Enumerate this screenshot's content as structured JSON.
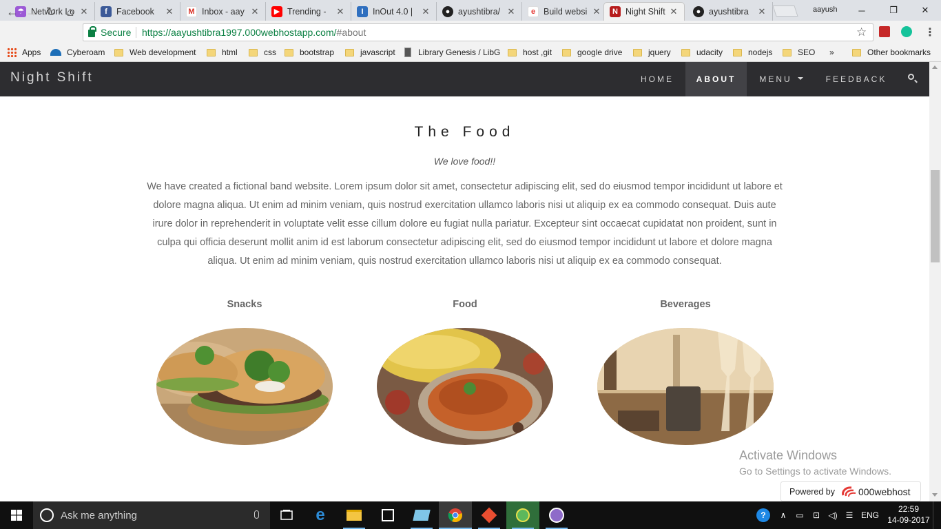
{
  "browser": {
    "tabs": [
      {
        "title": "Network Lo",
        "icon": "umbrella-icon",
        "color": "#9c5ad6"
      },
      {
        "title": "Facebook",
        "icon": "facebook-icon",
        "color": "#3b5998"
      },
      {
        "title": "Inbox - aay",
        "icon": "gmail-icon",
        "color": "#d93025"
      },
      {
        "title": "Trending - ",
        "icon": "youtube-icon",
        "color": "#ff0000"
      },
      {
        "title": "InOut 4.0 |",
        "icon": "inout-icon",
        "color": "#2f6fbf"
      },
      {
        "title": "ayushtibra/",
        "icon": "github-icon",
        "color": "#222222"
      },
      {
        "title": "Build websi",
        "icon": "webhost-icon",
        "color": "#e53935"
      },
      {
        "title": "Night Shift",
        "icon": "nightshift-icon",
        "color": "#b71c1c"
      },
      {
        "title": "ayushtibra",
        "icon": "github-icon",
        "color": "#222222"
      }
    ],
    "profile_name": "aayush",
    "url_secure_label": "Secure",
    "url_host": "https://aayushtibra1997.000webhostapp.com/",
    "url_path": "#about",
    "bookmarks": [
      {
        "label": "Apps",
        "type": "apps"
      },
      {
        "label": "Cyberoam",
        "type": "site"
      },
      {
        "label": "Web development",
        "type": "folder"
      },
      {
        "label": "html",
        "type": "folder"
      },
      {
        "label": "css",
        "type": "folder"
      },
      {
        "label": "bootstrap",
        "type": "folder"
      },
      {
        "label": "javascript",
        "type": "folder"
      },
      {
        "label": "Library Genesis / LibG",
        "type": "site"
      },
      {
        "label": "host ,git",
        "type": "folder"
      },
      {
        "label": "google drive",
        "type": "folder"
      },
      {
        "label": "jquery",
        "type": "folder"
      },
      {
        "label": "udacity",
        "type": "folder"
      },
      {
        "label": "nodejs",
        "type": "folder"
      },
      {
        "label": "SEO",
        "type": "folder"
      }
    ],
    "bookmarks_overflow": "»",
    "other_bookmarks": "Other bookmarks"
  },
  "site": {
    "brand": "Night Shift",
    "nav": [
      {
        "label": "HOME",
        "active": false
      },
      {
        "label": "ABOUT",
        "active": true
      },
      {
        "label": "MENU",
        "active": false
      },
      {
        "label": "FEEDBACK",
        "active": false
      }
    ],
    "section_title": "The Food",
    "section_subtitle": "We love food!!",
    "section_description": "We have created a fictional band website. Lorem ipsum dolor sit amet, consectetur adipiscing elit, sed do eiusmod tempor incididunt ut labore et dolore magna aliqua. Ut enim ad minim veniam, quis nostrud exercitation ullamco laboris nisi ut aliquip ex ea commodo consequat. Duis aute irure dolor in reprehenderit in voluptate velit esse cillum dolore eu fugiat nulla pariatur. Excepteur sint occaecat cupidatat non proident, sunt in culpa qui officia deserunt mollit anim id est laborum consectetur adipiscing elit, sed do eiusmod tempor incididunt ut labore et dolore magna aliqua. Ut enim ad minim veniam, quis nostrud exercitation ullamco laboris nisi ut aliquip ex ea commodo consequat.",
    "cards": [
      {
        "label": "Snacks"
      },
      {
        "label": "Food"
      },
      {
        "label": "Beverages"
      }
    ],
    "watermark_line1": "Activate Windows",
    "watermark_line2": "Go to Settings to activate Windows.",
    "powered_prefix": "Powered by",
    "powered_brand": "000webhost"
  },
  "taskbar": {
    "search_placeholder": "Ask me anything",
    "language": "ENG",
    "time": "22:59",
    "date": "14-09-2017"
  }
}
